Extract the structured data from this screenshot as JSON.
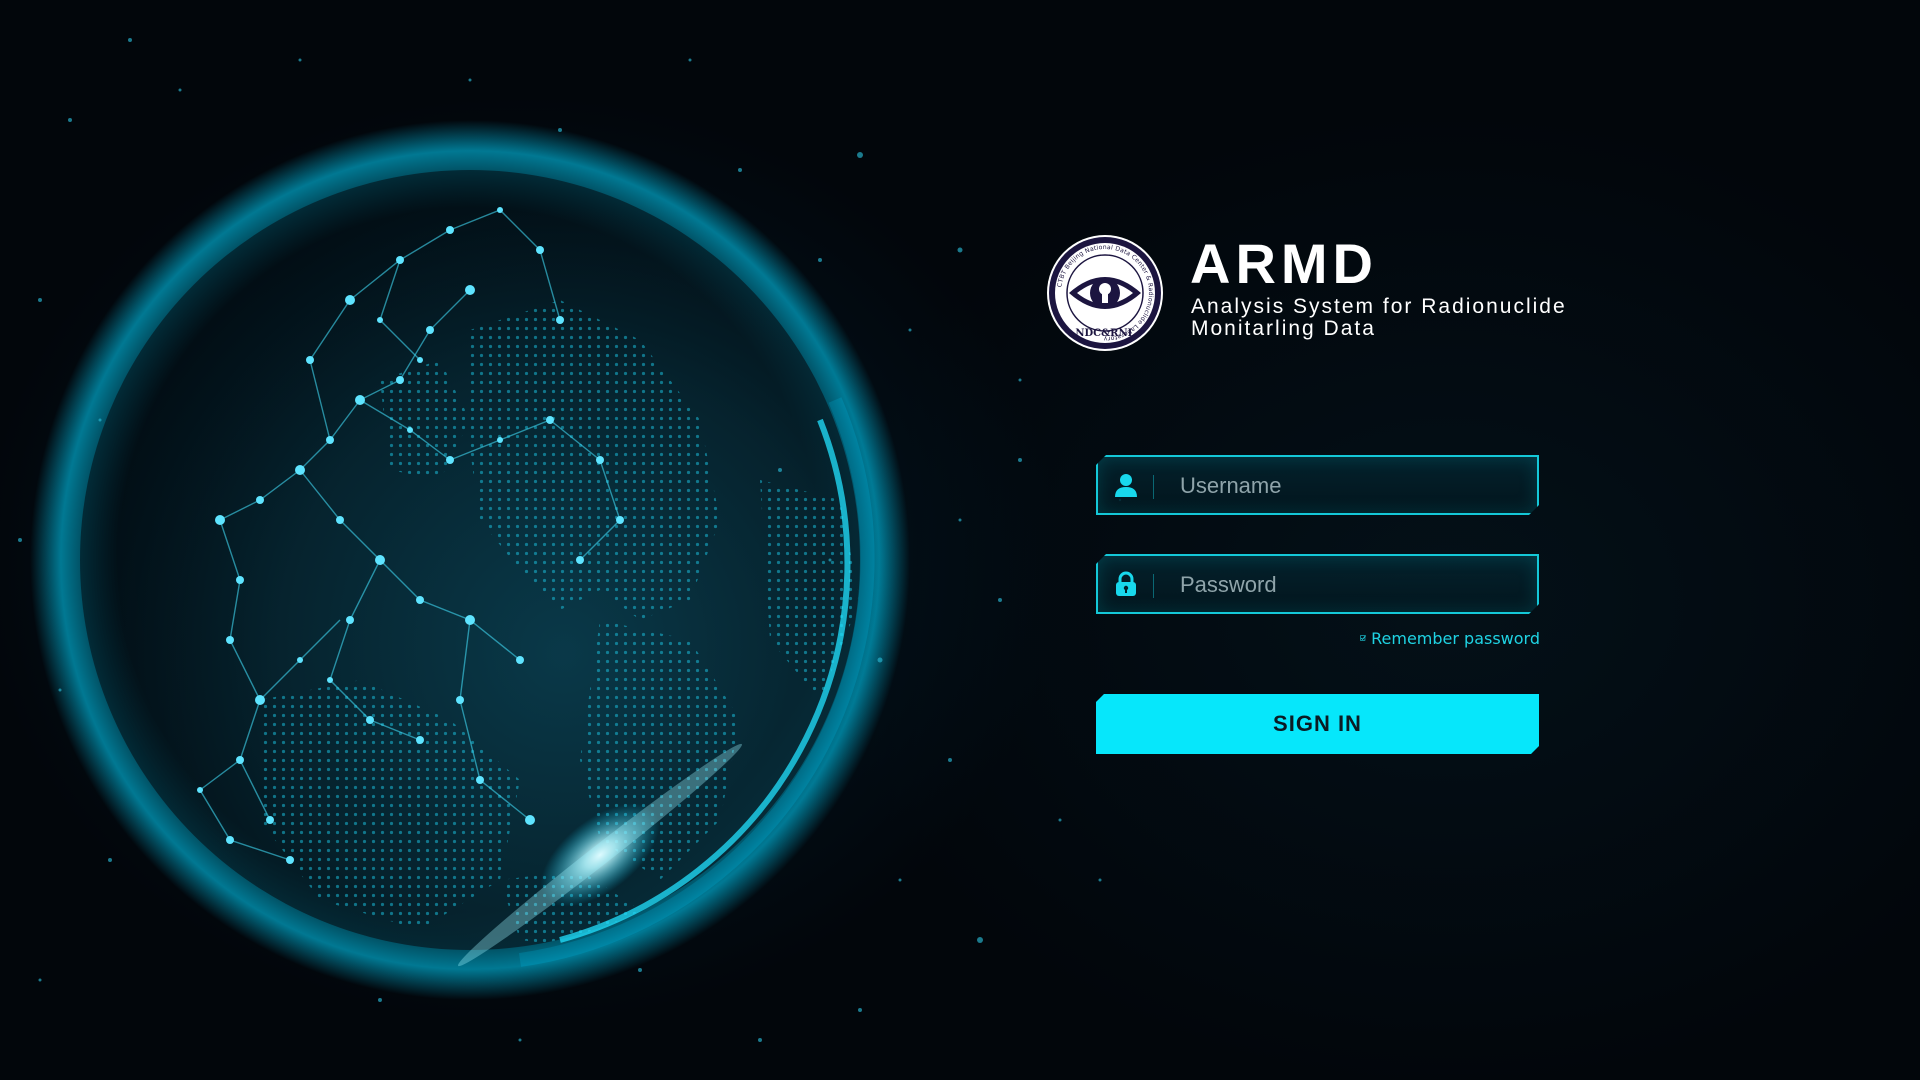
{
  "app": {
    "title": "ARMD",
    "subtitle": "Analysis System for Radionuclide Monitarling Data"
  },
  "logo": {
    "ring_text": "CTBT Beijing National Data Center & Radionuclide Laboratory",
    "bottom_text": "NDC&RNL"
  },
  "login": {
    "username_placeholder": "Username",
    "password_placeholder": "Password",
    "username_value": "",
    "password_value": "",
    "remember_label": "Remember password",
    "remember_checked": true,
    "submit_label": "SIGN IN"
  },
  "icons": {
    "username": "user-icon",
    "password": "lock-icon",
    "remember": "checkbox-checked-icon"
  },
  "colors": {
    "accent": "#06e7fb",
    "field_border": "#14c8d8",
    "background": "#02060b",
    "title": "#ffffff",
    "remember_text": "#1fd3e3"
  }
}
